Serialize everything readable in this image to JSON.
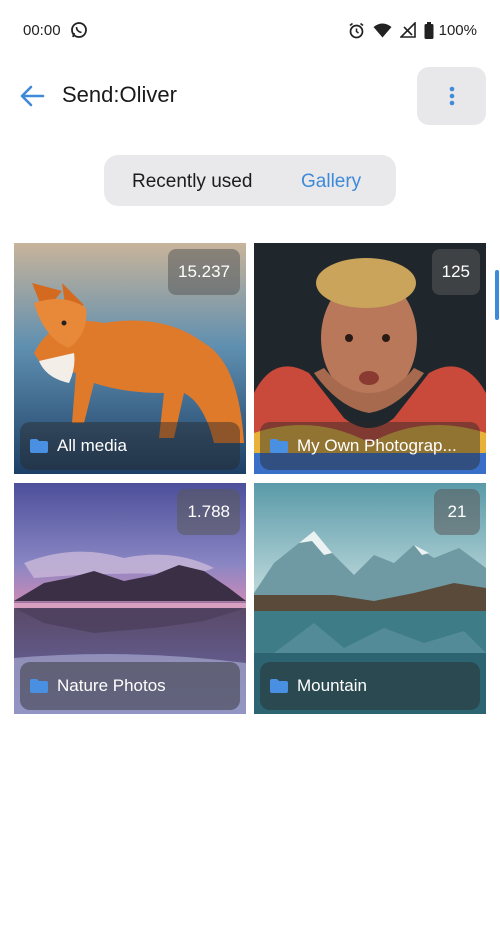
{
  "status_bar": {
    "time": "00:00",
    "battery": "100%",
    "icons": [
      "whatsapp-icon",
      "alarm-icon",
      "wifi-icon",
      "signal-icon",
      "battery-icon"
    ]
  },
  "app_bar": {
    "title": "Send:Oliver",
    "back_icon": "arrow-left-icon",
    "menu_icon": "more-vert-icon"
  },
  "tabs": {
    "items": [
      {
        "label": "Recently used",
        "selected": false
      },
      {
        "label": "Gallery",
        "selected": true
      }
    ]
  },
  "albums": [
    {
      "name": "All media",
      "count": "15.237",
      "thumbnail": "fox"
    },
    {
      "name": "My Own Photograp...",
      "count": "125",
      "thumbnail": "portrait"
    },
    {
      "name": "Nature Photos",
      "count": "1.788",
      "thumbnail": "mountain-lake-dusk"
    },
    {
      "name": "Mountain",
      "count": "21",
      "thumbnail": "mountain-lake"
    }
  ],
  "colors": {
    "accent": "#3e8ad8",
    "folder_icon": "#4a90e2",
    "segment_bg": "#e9e9eb",
    "menu_bg": "#e8e8ea"
  }
}
